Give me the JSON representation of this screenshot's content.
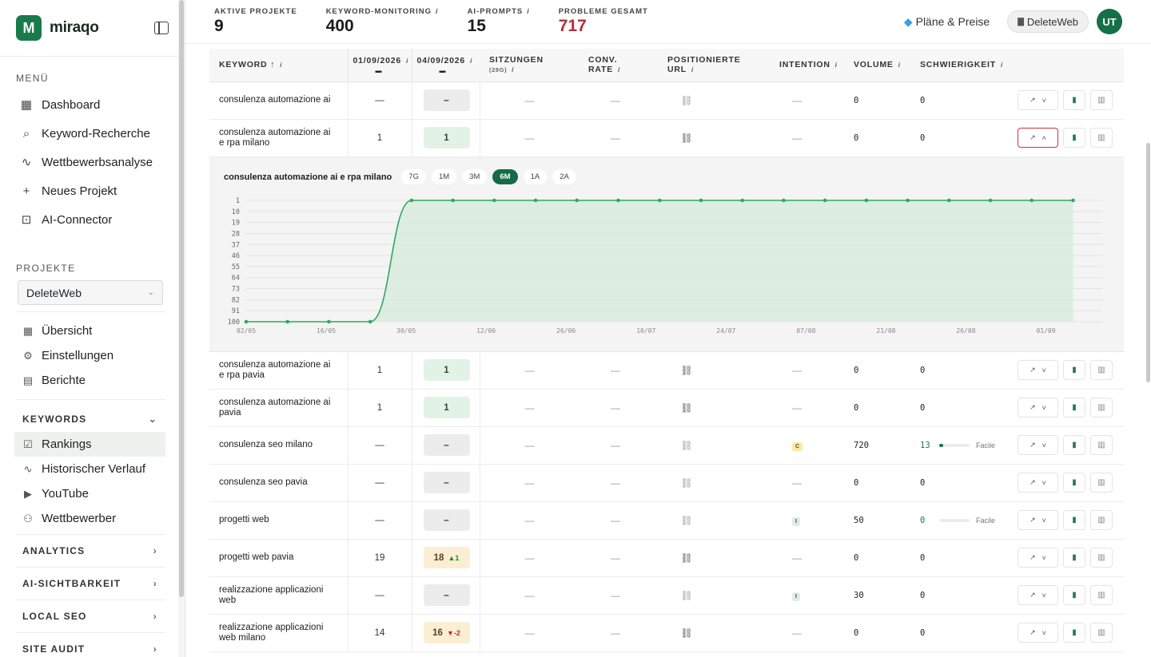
{
  "brand": {
    "name": "miraqo",
    "logo_letter": "M",
    "accent": "#1a7a4c"
  },
  "sidebar": {
    "menu_label": "MENÜ",
    "menu": [
      {
        "label": "Dashboard",
        "icon": "grid-icon"
      },
      {
        "label": "Keyword-Recherche",
        "icon": "search-icon"
      },
      {
        "label": "Wettbewerbsanalyse",
        "icon": "chart-line-icon"
      },
      {
        "label": "Neues Projekt",
        "icon": "plus-icon"
      },
      {
        "label": "AI-Connector",
        "icon": "robot-icon"
      }
    ],
    "projects_label": "PROJEKTE",
    "project_selected": "DeleteWeb",
    "project_items": [
      {
        "label": "Übersicht",
        "icon": "grid-icon"
      },
      {
        "label": "Einstellungen",
        "icon": "gear-icon"
      },
      {
        "label": "Berichte",
        "icon": "document-icon"
      }
    ],
    "keywords_group": "KEYWORDS",
    "keyword_items": [
      {
        "label": "Rankings",
        "icon": "checklist-icon",
        "active": true
      },
      {
        "label": "Historischer Verlauf",
        "icon": "pulse-icon"
      },
      {
        "label": "YouTube",
        "icon": "youtube-icon"
      },
      {
        "label": "Wettbewerber",
        "icon": "users-icon"
      }
    ],
    "groups": [
      "ANALYTICS",
      "AI-SICHTBARKEIT",
      "LOCAL SEO",
      "SITE AUDIT"
    ]
  },
  "topbar": {
    "stats": [
      {
        "label": "AKTIVE PROJEKTE",
        "value": "9",
        "info": false,
        "alert": false
      },
      {
        "label": "KEYWORD-MONITORING",
        "value": "400",
        "info": true,
        "alert": false
      },
      {
        "label": "AI-PROMPTS",
        "value": "15",
        "info": true,
        "alert": false
      },
      {
        "label": "PROBLEME GESAMT",
        "value": "717",
        "info": false,
        "alert": true
      }
    ],
    "plans_label": "Pläne & Preise",
    "workspace_label": "DeleteWeb",
    "avatar_initials": "UT",
    "alert_color": "#b0303a"
  },
  "table": {
    "headers": {
      "keyword": "KEYWORD ↑",
      "date1": "01/09/2026",
      "date2": "04/09/2026",
      "sessions": "SITZUNGEN",
      "sessions_note": "(28G)",
      "conv": "CONV. RATE",
      "url": "POSITIONIERTE URL",
      "intent": "INTENTION",
      "volume": "VOLUME",
      "difficulty": "SCHWIERIGKEIT"
    },
    "rows_before": [
      {
        "keyword": "consulenza automazione ai",
        "prev": "—",
        "cur": "–",
        "cur_style": "grey",
        "delta": "",
        "delta_dir": "",
        "sessions": "—",
        "conv": "—",
        "url_linked": false,
        "intent": "—",
        "intent_badge": "",
        "volume": "0",
        "difficulty": "0",
        "diff_label": "",
        "expanded": false
      },
      {
        "keyword": "consulenza automazione ai e rpa milano",
        "prev": "1",
        "cur": "1",
        "cur_style": "green",
        "delta": "",
        "delta_dir": "",
        "sessions": "—",
        "conv": "—",
        "url_linked": true,
        "intent": "—",
        "intent_badge": "",
        "volume": "0",
        "difficulty": "0",
        "diff_label": "",
        "expanded": true
      }
    ],
    "rows_after": [
      {
        "keyword": "consulenza automazione ai e rpa pavia",
        "prev": "1",
        "cur": "1",
        "cur_style": "green",
        "delta": "",
        "delta_dir": "",
        "sessions": "—",
        "conv": "—",
        "url_linked": true,
        "intent": "—",
        "intent_badge": "",
        "volume": "0",
        "difficulty": "0",
        "diff_label": "",
        "diff_pct": 0
      },
      {
        "keyword": "consulenza automazione ai pavia",
        "prev": "1",
        "cur": "1",
        "cur_style": "green",
        "delta": "",
        "delta_dir": "",
        "sessions": "—",
        "conv": "—",
        "url_linked": true,
        "intent": "—",
        "intent_badge": "",
        "volume": "0",
        "difficulty": "0",
        "diff_label": "",
        "diff_pct": 0
      },
      {
        "keyword": "consulenza seo milano",
        "prev": "—",
        "cur": "–",
        "cur_style": "grey",
        "delta": "",
        "delta_dir": "",
        "sessions": "—",
        "conv": "—",
        "url_linked": false,
        "intent": "",
        "intent_badge": "C",
        "volume": "720",
        "difficulty": "13",
        "diff_label": "Facile",
        "diff_pct": 13
      },
      {
        "keyword": "consulenza seo pavia",
        "prev": "—",
        "cur": "–",
        "cur_style": "grey",
        "delta": "",
        "delta_dir": "",
        "sessions": "—",
        "conv": "—",
        "url_linked": false,
        "intent": "—",
        "intent_badge": "",
        "volume": "0",
        "difficulty": "0",
        "diff_label": "",
        "diff_pct": 0
      },
      {
        "keyword": "progetti web",
        "prev": "—",
        "cur": "–",
        "cur_style": "grey",
        "delta": "",
        "delta_dir": "",
        "sessions": "—",
        "conv": "—",
        "url_linked": false,
        "intent": "",
        "intent_badge": "I",
        "volume": "50",
        "difficulty": "0",
        "diff_label": "Facile",
        "diff_pct": 0
      },
      {
        "keyword": "progetti web pavia",
        "prev": "19",
        "cur": "18",
        "cur_style": "amber",
        "delta": "▲1",
        "delta_dir": "up",
        "sessions": "—",
        "conv": "—",
        "url_linked": true,
        "intent": "—",
        "intent_badge": "",
        "volume": "0",
        "difficulty": "0",
        "diff_label": "",
        "diff_pct": 0
      },
      {
        "keyword": "realizzazione applicazioni web",
        "prev": "—",
        "cur": "–",
        "cur_style": "grey",
        "delta": "",
        "delta_dir": "",
        "sessions": "—",
        "conv": "—",
        "url_linked": false,
        "intent": "",
        "intent_badge": "I",
        "volume": "30",
        "difficulty": "0",
        "diff_label": "",
        "diff_pct": 0
      },
      {
        "keyword": "realizzazione applicazioni web milano",
        "prev": "14",
        "cur": "16",
        "cur_style": "amber",
        "delta": "▼-2",
        "delta_dir": "down",
        "sessions": "—",
        "conv": "—",
        "url_linked": true,
        "intent": "—",
        "intent_badge": "",
        "volume": "0",
        "difficulty": "0",
        "diff_label": "",
        "diff_pct": 0
      }
    ]
  },
  "expanded_chart": {
    "title": "consulenza automazione ai e rpa milano",
    "ranges": [
      "7G",
      "1M",
      "3M",
      "6M",
      "1A",
      "2A"
    ],
    "selected_range": "6M"
  },
  "chart_data": {
    "type": "area",
    "title": "consulenza automazione ai e rpa milano",
    "xlabel": "",
    "ylabel": "",
    "y_ticks": [
      1,
      10,
      19,
      28,
      37,
      46,
      55,
      64,
      73,
      82,
      91,
      100
    ],
    "ylim": [
      100,
      1
    ],
    "y_inverted": true,
    "x_tick_labels": [
      "02/05",
      "16/05",
      "30/05",
      "12/06",
      "26/06",
      "10/07",
      "24/07",
      "07/08",
      "21/08",
      "26/08",
      "01/09"
    ],
    "x": [
      "02/05",
      "09/05",
      "16/05",
      "23/05",
      "30/05",
      "06/06",
      "12/06",
      "19/06",
      "26/06",
      "03/07",
      "10/07",
      "17/07",
      "24/07",
      "31/07",
      "07/08",
      "14/08",
      "21/08",
      "28/08",
      "04/09",
      "11/09",
      "18/09"
    ],
    "values": [
      100,
      100,
      100,
      100,
      1,
      1,
      1,
      1,
      1,
      1,
      1,
      1,
      1,
      1,
      1,
      1,
      1,
      1,
      1,
      1,
      1
    ],
    "line_color": "#2eaa5c",
    "fill_color": "#d7ebdc",
    "grid": true
  }
}
